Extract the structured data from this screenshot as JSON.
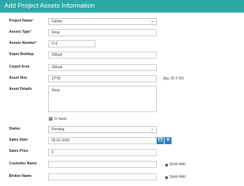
{
  "header": {
    "title": "Add Project Assets Information"
  },
  "fields": {
    "project_name": {
      "label": "Project Name",
      "value": "Calista"
    },
    "assets_type": {
      "label": "Assets Type",
      "value": "Shop"
    },
    "assets_number": {
      "label": "Assets Number",
      "value": "G-6"
    },
    "super_buildup": {
      "label": "Super Buildup",
      "value": "250sqf"
    },
    "carpet_area": {
      "label": "Carpet Area",
      "value": "200sqf"
    },
    "asset_size": {
      "label": "Asset Size",
      "value": "12*36",
      "hint": "(Eg. 25 X 50)"
    },
    "asset_details": {
      "label": "Asset Details",
      "value": "Shop"
    },
    "is_vastu": {
      "label": "Is Vastu",
      "checked": true
    },
    "status": {
      "label": "Status",
      "value": "Pending"
    },
    "sales_date": {
      "label": "Sales Date:",
      "value": "05-02-2020"
    },
    "sales_price": {
      "label": "Sales Price",
      "value": "0"
    },
    "customer_name": {
      "label": "Customer Name",
      "value": "",
      "quick_add": "Quick Add"
    },
    "broker_name": {
      "label": "Broker Name",
      "value": "",
      "quick_add": "Quick Add"
    }
  },
  "required_marker": "*",
  "icons": {
    "calendar": "calendar-icon",
    "clear": "clear-icon",
    "plus": "plus-icon"
  },
  "colors": {
    "header_bg": "#2ba8a8",
    "button_blue": "#2a7fbd"
  }
}
